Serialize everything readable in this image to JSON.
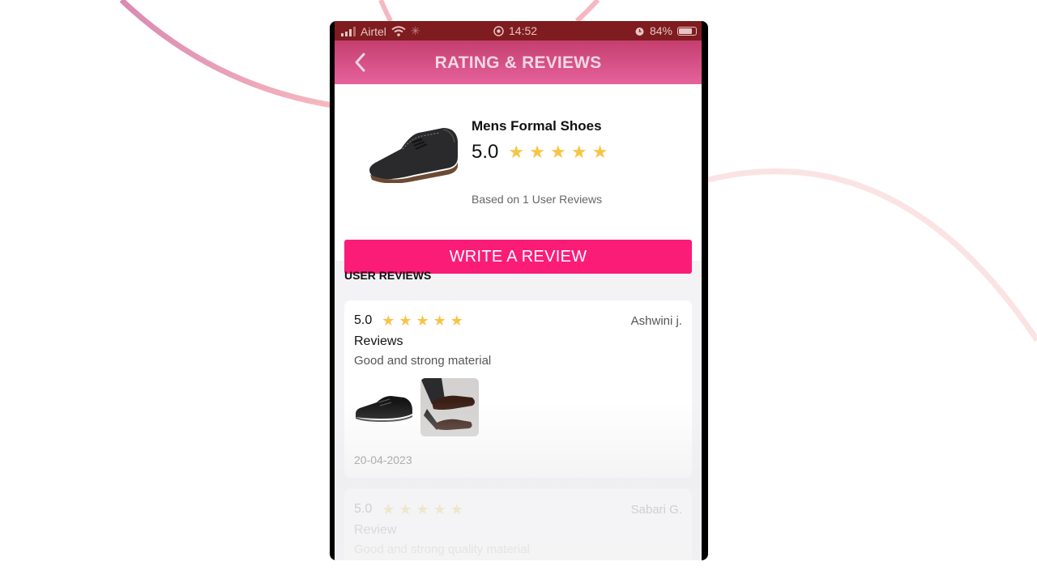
{
  "status_bar": {
    "carrier": "Airtel",
    "time": "14:52",
    "battery": "84%"
  },
  "header": {
    "title": "RATING & REVIEWS"
  },
  "product": {
    "name": "Mens Formal Shoes",
    "rating": "5.0",
    "stars": "★ ★ ★ ★ ★",
    "based_on": "Based on 1 User Reviews"
  },
  "write_review_label": "WRITE A REVIEW",
  "section_title": "USER REVIEWS",
  "reviews": [
    {
      "rating": "5.0",
      "stars": "★ ★ ★ ★ ★",
      "author": "Ashwini j.",
      "title": "Reviews",
      "body": "Good and strong material",
      "date": "20-04-2023"
    },
    {
      "rating": "5.0",
      "stars": "★ ★ ★ ★ ★",
      "author": "Sabari G.",
      "title": "Review",
      "body": "Good and strong quality material"
    }
  ],
  "colors": {
    "accent": "#fb1c78",
    "header_gradient_top": "#c43e6f",
    "header_gradient_bottom": "#e5629b",
    "star": "#f7c545"
  }
}
